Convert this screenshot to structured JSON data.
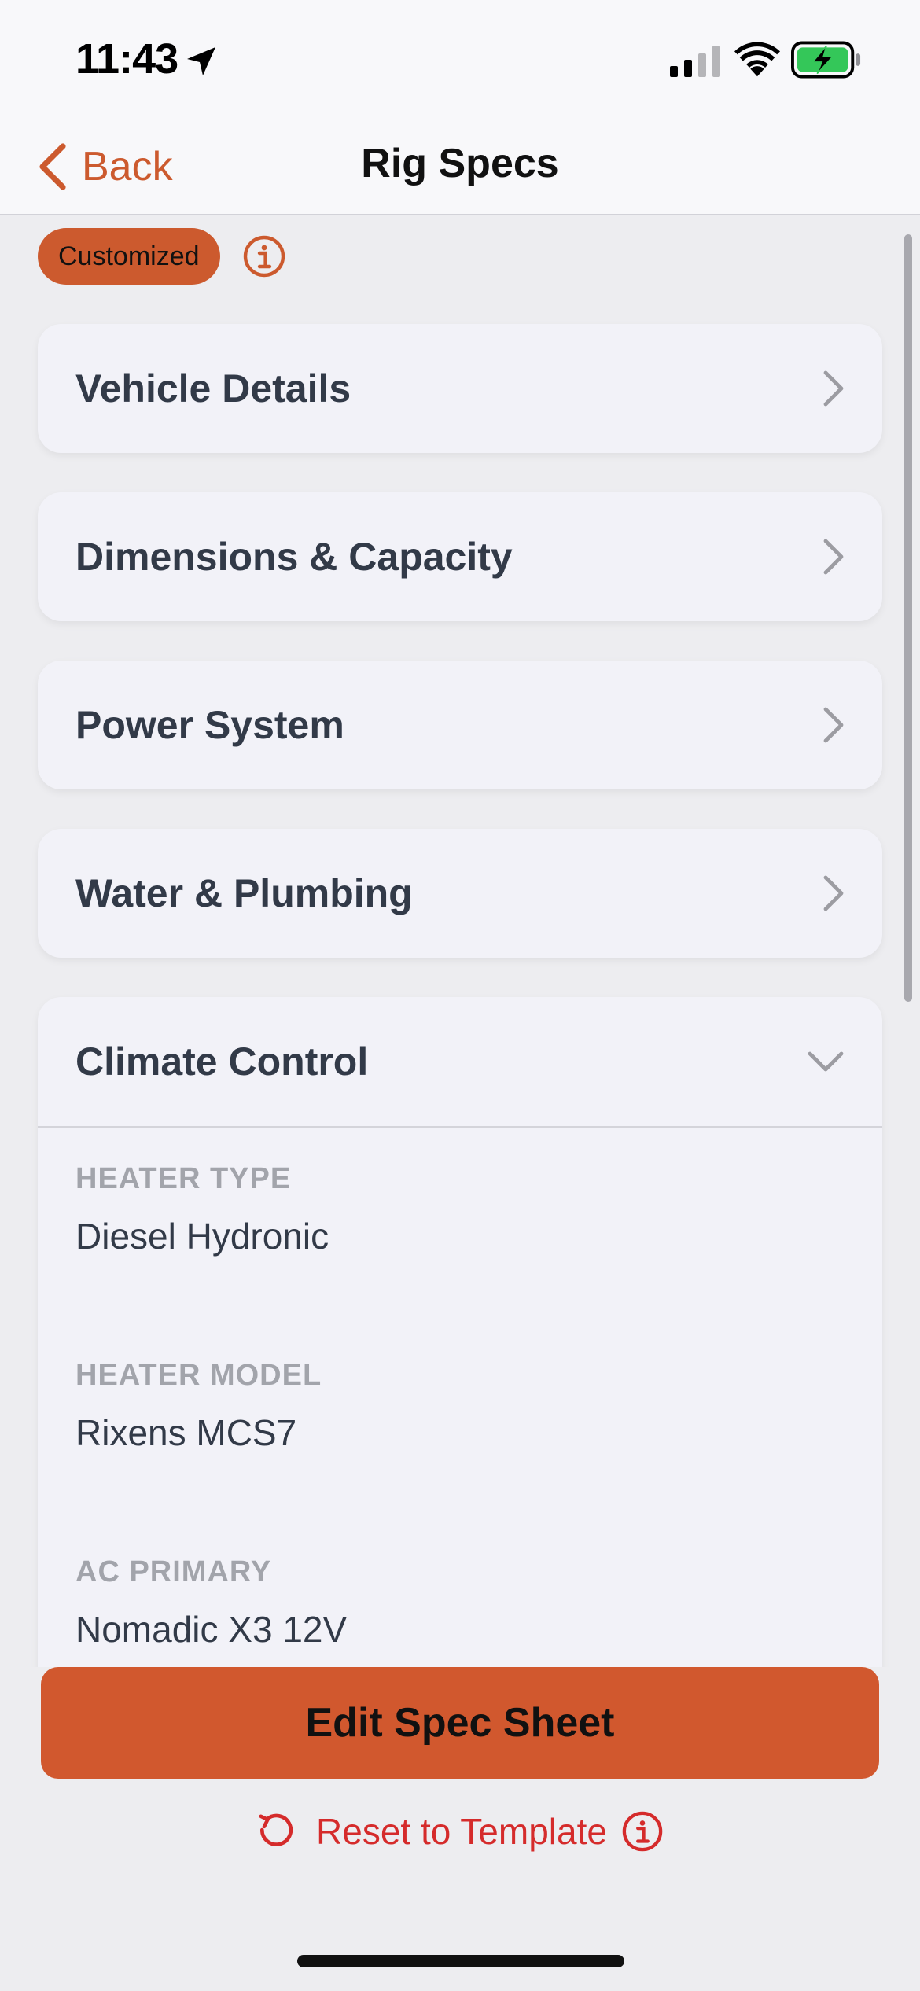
{
  "status_bar": {
    "time": "11:43",
    "icons": [
      "location-arrow-icon",
      "cellular-signal-icon",
      "wifi-icon",
      "battery-charging-icon"
    ]
  },
  "nav": {
    "back_label": "Back",
    "title": "Rig Specs"
  },
  "badge": {
    "label": "Customized",
    "icon": "info-icon"
  },
  "sections": [
    {
      "title": "Vehicle Details",
      "expanded": false
    },
    {
      "title": "Dimensions & Capacity",
      "expanded": false
    },
    {
      "title": "Power System",
      "expanded": false
    },
    {
      "title": "Water & Plumbing",
      "expanded": false
    },
    {
      "title": "Climate Control",
      "expanded": true,
      "fields": [
        {
          "label": "HEATER TYPE",
          "value": "Diesel Hydronic"
        },
        {
          "label": "HEATER MODEL",
          "value": "Rixens MCS7"
        },
        {
          "label": "AC PRIMARY",
          "value": "Nomadic X3 12V"
        }
      ]
    }
  ],
  "actions": {
    "edit_label": "Edit Spec Sheet",
    "reset_label": "Reset to Template"
  },
  "colors": {
    "accent": "#CC5A2E",
    "button": "#D1582E",
    "danger": "#D52B2B",
    "card": "#F2F2F8",
    "background": "#EDEDF0",
    "battery_charging": "#34C759"
  }
}
